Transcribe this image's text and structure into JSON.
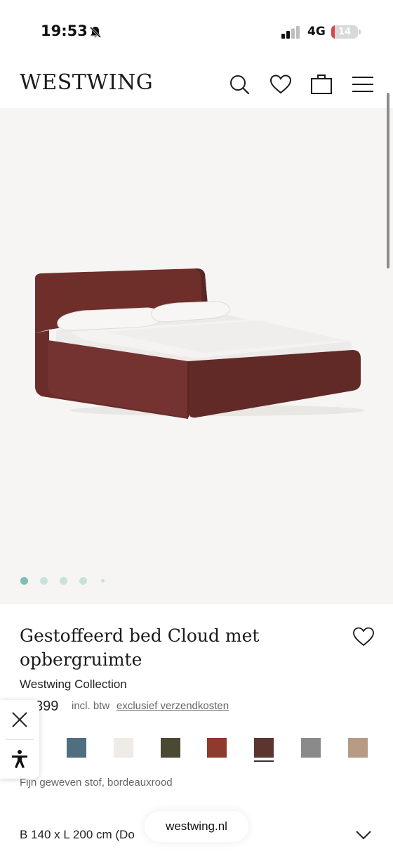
{
  "status_bar": {
    "time": "19:53",
    "network": "4G",
    "battery": {
      "level_percent": 14,
      "label": "14",
      "color": "#e0414a"
    }
  },
  "header": {
    "logo": "WESTWING",
    "icons": [
      "search-icon",
      "heart-icon",
      "shopping-bag-icon",
      "menu-icon"
    ]
  },
  "gallery": {
    "image_count": 5,
    "active_index": 0,
    "dot_active_color": "#7fbfb2",
    "dot_color": "#c5e3dd"
  },
  "product": {
    "title": "Gestoffeerd bed Cloud met opbergruimte",
    "brand": "Westwing Collection",
    "price": "399",
    "vat_note": "incl. btw",
    "shipping_link": "exclusief verzendkosten",
    "color_description": "Fijn geweven stof, bordeauxrood",
    "swatches": [
      {
        "name": "blue-grey",
        "color": "#4f6f80",
        "selected": false
      },
      {
        "name": "off-white",
        "color": "#efebe7",
        "selected": false
      },
      {
        "name": "olive",
        "color": "#4b4833",
        "selected": false
      },
      {
        "name": "rust-red",
        "color": "#8e3a2c",
        "selected": false
      },
      {
        "name": "bordeaux",
        "color": "#5c3530",
        "selected": true
      },
      {
        "name": "grey",
        "color": "#8a8a8a",
        "selected": false
      },
      {
        "name": "taupe",
        "color": "#b79b85",
        "selected": false
      }
    ],
    "size": "B 140 x L 200 cm (Do"
  },
  "browser": {
    "url": "westwing.nl"
  }
}
